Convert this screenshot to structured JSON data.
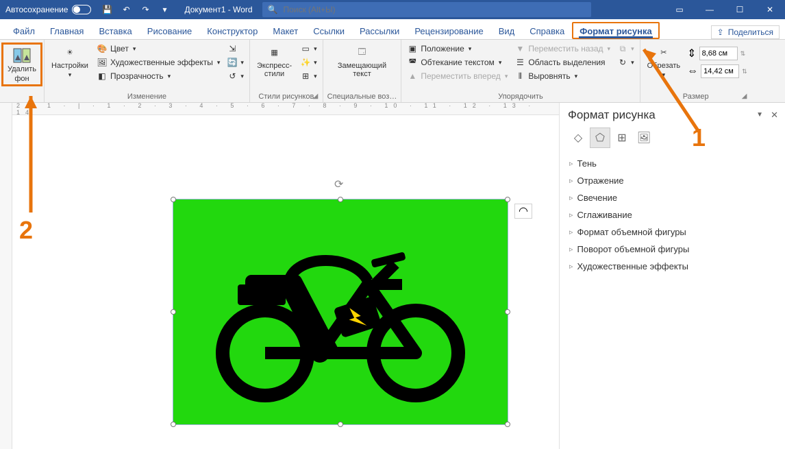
{
  "titlebar": {
    "autosave": "Автосохранение",
    "doc": "Документ1 - Word",
    "searchPlaceholder": "Поиск (Alt+Ы)"
  },
  "tabs": {
    "file": "Файл",
    "home": "Главная",
    "insert": "Вставка",
    "draw": "Рисование",
    "design": "Конструктор",
    "layout": "Макет",
    "references": "Ссылки",
    "mailings": "Рассылки",
    "review": "Рецензирование",
    "view": "Вид",
    "help": "Справка",
    "pictureFormat": "Формат рисунка",
    "share": "Поделиться"
  },
  "ribbon": {
    "removeBgLine1": "Удалить",
    "removeBgLine2": "фон",
    "corrections": "Настройки",
    "color": "Цвет",
    "artistic": "Художественные эффекты",
    "transparency": "Прозрачность",
    "changeGroup": "Изменение",
    "stylesBtn": "Экспресс-\nстили",
    "stylesGroup": "Стили рисунков",
    "altText": "Замещающий\nтекст",
    "altGroup": "Специальные воз…",
    "position": "Положение",
    "wrap": "Обтекание текстом",
    "forward": "Переместить вперед",
    "backward": "Переместить назад",
    "selectionPane": "Область выделения",
    "align": "Выровнять",
    "arrangeGroup": "Упорядочить",
    "crop": "Обрезать",
    "height": "8,68 см",
    "width": "14,42 см",
    "sizeGroup": "Размер"
  },
  "rulerTicks": "2 · 1 · | · 1 · 2 · 3 · 4 · 5 · 6 · 7 · 8 · 9 · 10 · 11 · 12 · 13 · 14",
  "sidePane": {
    "title": "Формат рисунка",
    "items": [
      "Тень",
      "Отражение",
      "Свечение",
      "Сглаживание",
      "Формат объемной фигуры",
      "Поворот объемной фигуры",
      "Художественные эффекты"
    ]
  },
  "annotations": {
    "one": "1",
    "two": "2"
  }
}
